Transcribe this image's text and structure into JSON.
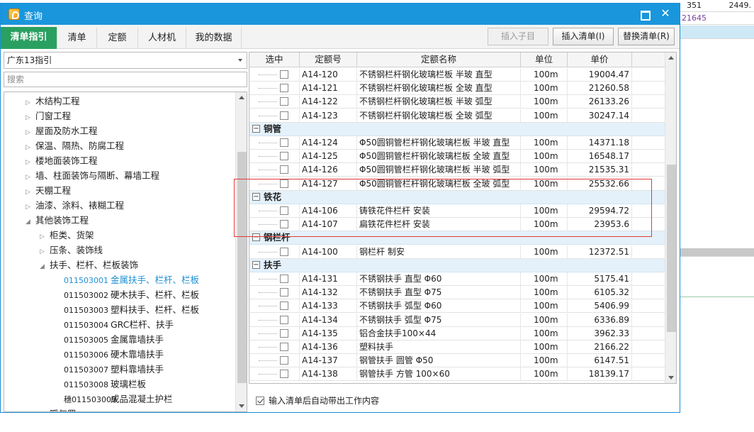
{
  "background_sheet": {
    "cell_1": "351",
    "cell_2": "2449.",
    "cell_3": "21645"
  },
  "window": {
    "title": "查询"
  },
  "tabs": [
    {
      "label": "清单指引",
      "active": true
    },
    {
      "label": "清单"
    },
    {
      "label": "定额"
    },
    {
      "label": "人材机"
    },
    {
      "label": "我的数据"
    }
  ],
  "toolbar": {
    "insert_sub": "插入子目",
    "insert_list": "插入清单(I)",
    "replace_list": "替换清单(R)"
  },
  "left": {
    "region": "广东13指引",
    "search_placeholder": "搜索",
    "tree": [
      {
        "label": "木结构工程",
        "level": 1,
        "expand": "closed"
      },
      {
        "label": "门窗工程",
        "level": 1,
        "expand": "closed"
      },
      {
        "label": "屋面及防水工程",
        "level": 1,
        "expand": "closed"
      },
      {
        "label": "保温、隔热、防腐工程",
        "level": 1,
        "expand": "closed"
      },
      {
        "label": "楼地面装饰工程",
        "level": 1,
        "expand": "closed"
      },
      {
        "label": "墙、柱面装饰与隔断、幕墙工程",
        "level": 1,
        "expand": "closed"
      },
      {
        "label": "天棚工程",
        "level": 1,
        "expand": "closed"
      },
      {
        "label": "油漆、涂料、裱糊工程",
        "level": 1,
        "expand": "closed"
      },
      {
        "label": "其他装饰工程",
        "level": 1,
        "expand": "open"
      },
      {
        "label": "柜类、货架",
        "level": 2,
        "expand": "closed"
      },
      {
        "label": "压条、装饰线",
        "level": 2,
        "expand": "closed"
      },
      {
        "label": "扶手、栏杆、栏板装饰",
        "level": 2,
        "expand": "open"
      },
      {
        "code": "011503001",
        "label": "金属扶手、栏杆、栏板",
        "level": 3,
        "selected": true
      },
      {
        "code": "011503002",
        "label": "硬木扶手、栏杆、栏板",
        "level": 3
      },
      {
        "code": "011503003",
        "label": "塑料扶手、栏杆、栏板",
        "level": 3
      },
      {
        "code": "011503004",
        "label": "GRC栏杆、扶手",
        "level": 3
      },
      {
        "code": "011503005",
        "label": "金属靠墙扶手",
        "level": 3
      },
      {
        "code": "011503006",
        "label": "硬木靠墙扶手",
        "level": 3
      },
      {
        "code": "011503007",
        "label": "塑料靠墙扶手",
        "level": 3
      },
      {
        "code": "011503008",
        "label": "玻璃栏板",
        "level": 3
      },
      {
        "code": "穗011503009",
        "label": "成品混凝土护栏",
        "level": 3
      },
      {
        "label": "暖气罩",
        "level": 2,
        "expand": "closed"
      }
    ]
  },
  "grid": {
    "columns": [
      "选中",
      "定额号",
      "定额名称",
      "单位",
      "单价"
    ],
    "rows": [
      {
        "type": "item",
        "code": "A14-120",
        "name": "不锈钢栏杆钢化玻璃栏板 半玻 直型",
        "unit": "100m",
        "price": "19004.47"
      },
      {
        "type": "item",
        "code": "A14-121",
        "name": "不锈钢栏杆钢化玻璃栏板 全玻 直型",
        "unit": "100m",
        "price": "21260.58"
      },
      {
        "type": "item",
        "code": "A14-122",
        "name": "不锈钢栏杆钢化玻璃栏板 半玻 弧型",
        "unit": "100m",
        "price": "26133.26"
      },
      {
        "type": "item",
        "code": "A14-123",
        "name": "不锈钢栏杆钢化玻璃栏板 全玻 弧型",
        "unit": "100m",
        "price": "30247.14"
      },
      {
        "type": "group",
        "label": "铜管"
      },
      {
        "type": "item",
        "code": "A14-124",
        "name": "Φ50圆铜管栏杆钢化玻璃栏板 半玻 直型",
        "unit": "100m",
        "price": "14371.18"
      },
      {
        "type": "item",
        "code": "A14-125",
        "name": "Φ50圆铜管栏杆钢化玻璃栏板 全玻 直型",
        "unit": "100m",
        "price": "16548.17"
      },
      {
        "type": "item",
        "code": "A14-126",
        "name": "Φ50圆铜管栏杆钢化玻璃栏板 半玻 弧型",
        "unit": "100m",
        "price": "21535.31"
      },
      {
        "type": "item",
        "code": "A14-127",
        "name": "Φ50圆铜管栏杆钢化玻璃栏板 全玻 弧型",
        "unit": "100m",
        "price": "25532.66"
      },
      {
        "type": "group",
        "label": "铁花"
      },
      {
        "type": "item",
        "code": "A14-106",
        "name": "铸铁花件栏杆 安装",
        "unit": "100m",
        "price": "29594.72"
      },
      {
        "type": "item",
        "code": "A14-107",
        "name": "扁铁花件栏杆 安装",
        "unit": "100m",
        "price": "23953.6"
      },
      {
        "type": "group",
        "label": "钢栏杆"
      },
      {
        "type": "item",
        "code": "A14-100",
        "name": "钢栏杆 制安",
        "unit": "100m",
        "price": "12372.51"
      },
      {
        "type": "group",
        "label": "扶手"
      },
      {
        "type": "item",
        "code": "A14-131",
        "name": "不锈钢扶手 直型 Φ60",
        "unit": "100m",
        "price": "5175.41"
      },
      {
        "type": "item",
        "code": "A14-132",
        "name": "不锈钢扶手 直型 Φ75",
        "unit": "100m",
        "price": "6105.32"
      },
      {
        "type": "item",
        "code": "A14-133",
        "name": "不锈钢扶手 弧型 Φ60",
        "unit": "100m",
        "price": "5406.99"
      },
      {
        "type": "item",
        "code": "A14-134",
        "name": "不锈钢扶手 弧型 Φ75",
        "unit": "100m",
        "price": "6336.89"
      },
      {
        "type": "item",
        "code": "A14-135",
        "name": "铝合金扶手100×44",
        "unit": "100m",
        "price": "3962.33"
      },
      {
        "type": "item",
        "code": "A14-136",
        "name": "塑料扶手",
        "unit": "100m",
        "price": "2166.22"
      },
      {
        "type": "item",
        "code": "A14-137",
        "name": "钢管扶手 圆管 Φ50",
        "unit": "100m",
        "price": "6147.51"
      },
      {
        "type": "item",
        "code": "A14-138",
        "name": "钢管扶手 方管 100×60",
        "unit": "100m",
        "price": "18139.17"
      }
    ]
  },
  "footer": {
    "auto_content_label": "输入清单后自动带出工作内容",
    "auto_content_checked": true
  },
  "colors": {
    "title_bar": "#1a96dc",
    "active_tab": "#2aa060",
    "selected_text": "#1e8fd4",
    "highlight_box": "#e33b3b",
    "group_row": "#e4f1fb"
  }
}
